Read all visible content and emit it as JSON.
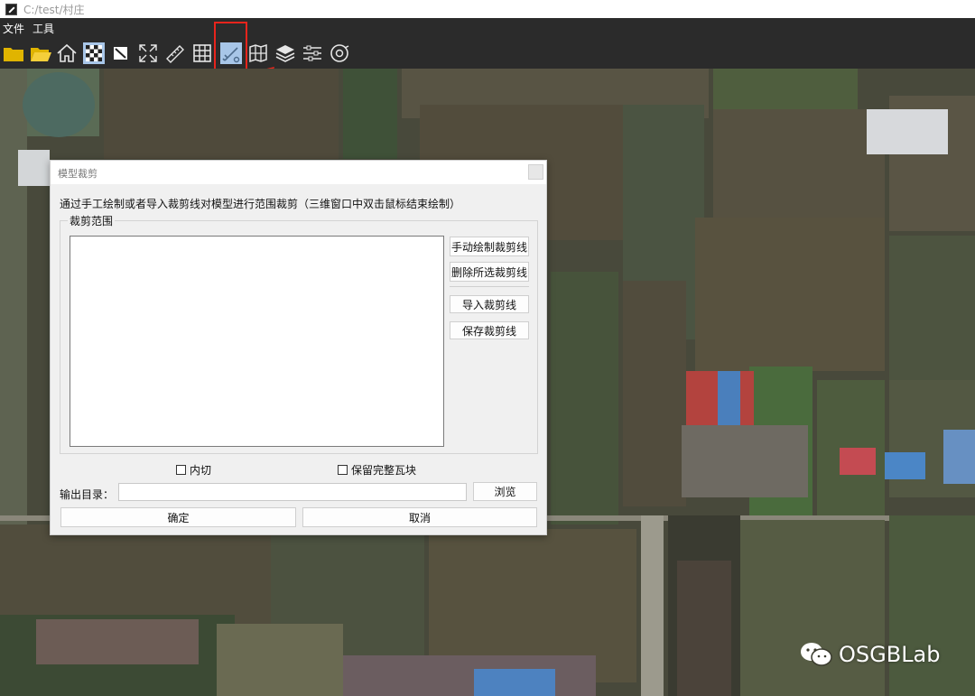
{
  "window": {
    "title": "C:/test/村庄"
  },
  "menu": {
    "file": "文件",
    "tools": "工具"
  },
  "toolbar": {
    "icons": [
      "folder-icon",
      "open-folder-icon",
      "home-icon",
      "texture-icon",
      "square-icon",
      "fullscreen-icon",
      "ruler-icon",
      "grid-icon",
      "clip-icon",
      "map-book-icon",
      "layers-icon",
      "settings-sliders-icon",
      "export-icon"
    ],
    "highlight_color": "#e8241c"
  },
  "dialog": {
    "title": "模型裁剪",
    "instruction": "通过手工绘制或者导入裁剪线对模型进行范围裁剪（三维窗口中双击鼠标结束绘制）",
    "group_label": "裁剪范围",
    "buttons": {
      "draw": "手动绘制裁剪线",
      "delete": "删除所选裁剪线",
      "import": "导入裁剪线",
      "save": "保存裁剪线",
      "browse": "浏览",
      "ok": "确定",
      "cancel": "取消"
    },
    "checkboxes": {
      "inner_clip": "内切",
      "keep_tiles": "保留完整瓦块"
    },
    "output_label": "输出目录：",
    "output_value": ""
  },
  "watermark": {
    "text": "OSGBLab"
  }
}
